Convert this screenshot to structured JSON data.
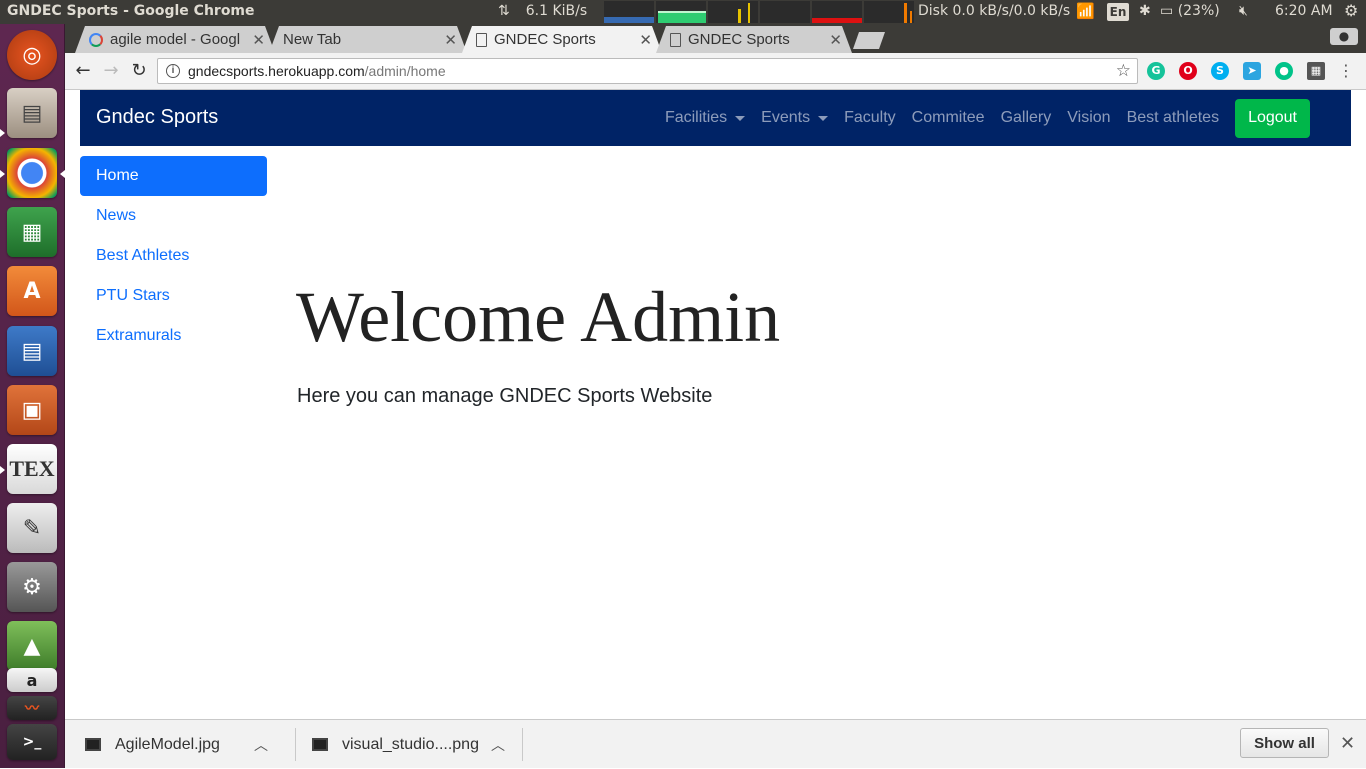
{
  "panel": {
    "window_title": "GNDEC Sports - Google Chrome",
    "net_speed": "6.1 KiB/s",
    "disk": "Disk 0.0 kB/s/0.0 kB/s",
    "lang": "En",
    "battery": "(23%)",
    "clock": "6:20 AM"
  },
  "launcher": {
    "apps": [
      "ubuntu-dash-icon",
      "files-icon",
      "chrome-icon",
      "calc-icon",
      "software-center-icon",
      "writer-icon",
      "impress-icon",
      "texmaker-icon",
      "text-editor-icon",
      "system-settings-icon",
      "android-studio-icon",
      "amazon-icon",
      "system-monitor-icon",
      "terminal-icon"
    ]
  },
  "chrome": {
    "tabs": [
      {
        "label": "agile model - Googl",
        "icon": "google-icon"
      },
      {
        "label": "New Tab",
        "icon": ""
      },
      {
        "label": "GNDEC Sports",
        "icon": "page-icon",
        "active": true
      },
      {
        "label": "GNDEC Sports",
        "icon": "page-icon"
      }
    ],
    "url_host": "gndecsports.herokuapp.com",
    "url_path": "/admin/home"
  },
  "site": {
    "brand": "Gndec Sports",
    "nav": {
      "facilities": "Facilities",
      "events": "Events",
      "faculty": "Faculty",
      "commitee": "Commitee",
      "gallery": "Gallery",
      "vision": "Vision",
      "best_athletes": "Best athletes",
      "logout": "Logout"
    },
    "sidebar": [
      {
        "label": "Home",
        "active": true
      },
      {
        "label": "News"
      },
      {
        "label": "Best Athletes"
      },
      {
        "label": "PTU Stars"
      },
      {
        "label": "Extramurals"
      }
    ],
    "heading": "Welcome Admin",
    "subheading": "Here you can manage GNDEC Sports Website",
    "colors": {
      "navbar": "#002366",
      "active": "#0d6efd",
      "logout": "#00b74a"
    }
  },
  "downloads": {
    "items": [
      {
        "name": "AgileModel.jpg"
      },
      {
        "name": "visual_studio....png"
      }
    ],
    "show_all": "Show all"
  }
}
